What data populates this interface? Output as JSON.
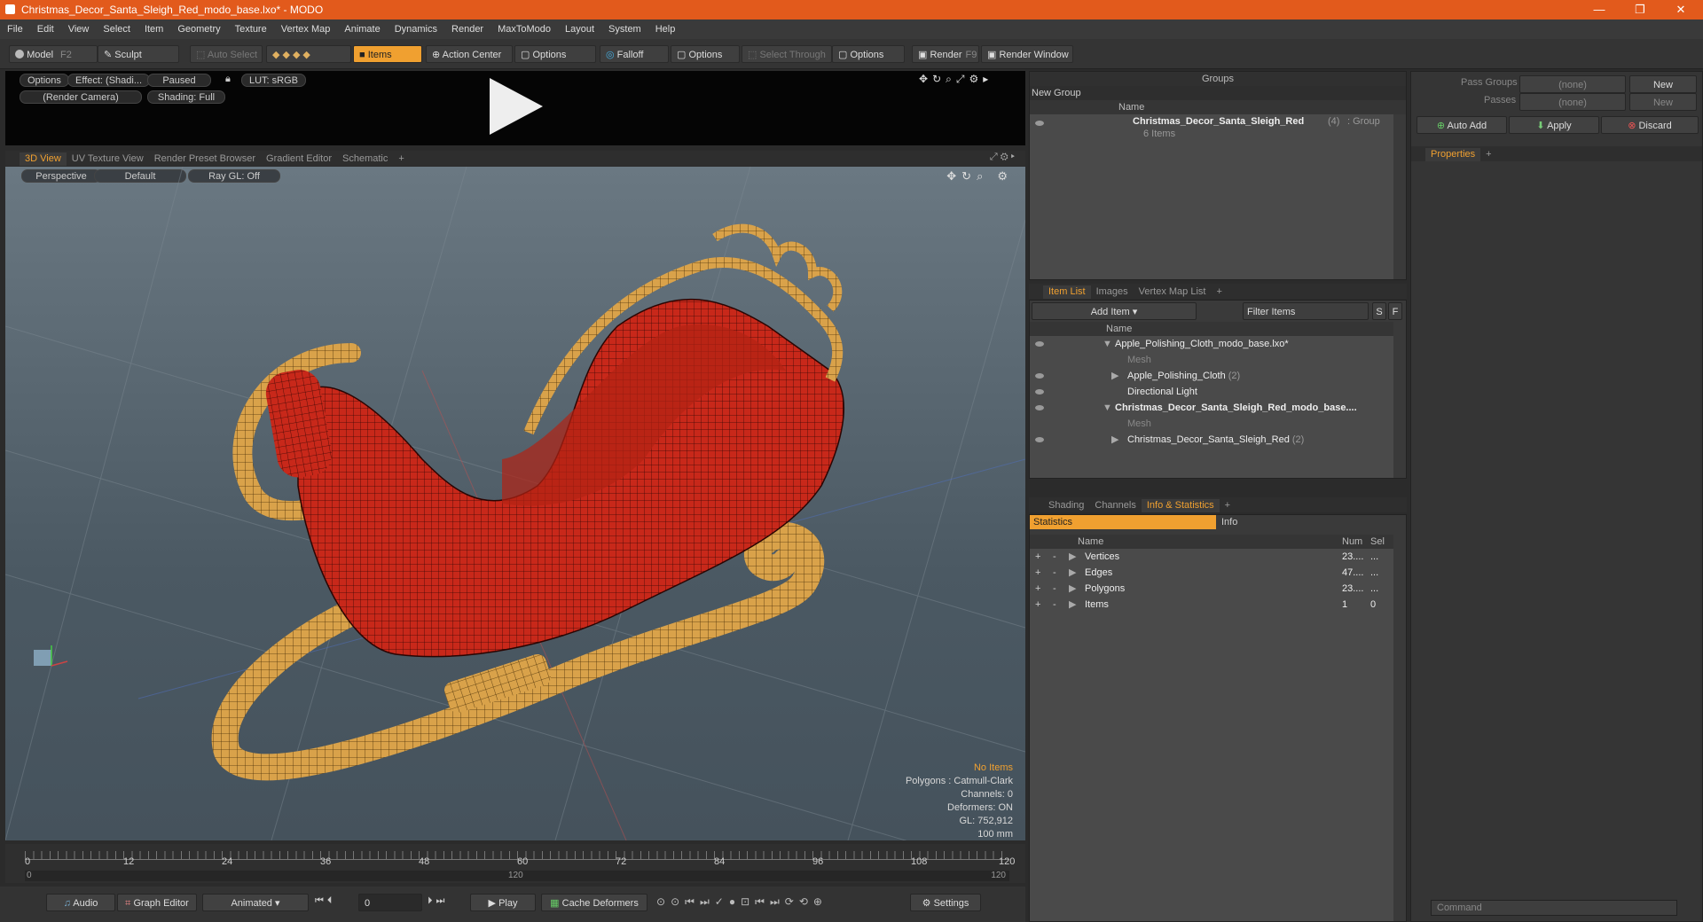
{
  "window": {
    "title": "Christmas_Decor_Santa_Sleigh_Red_modo_base.lxo* - MODO",
    "minimize": "—",
    "maximize": "❐",
    "close": "✕"
  },
  "menu": [
    "File",
    "Edit",
    "View",
    "Select",
    "Item",
    "Geometry",
    "Texture",
    "Vertex Map",
    "Animate",
    "Dynamics",
    "Render",
    "MaxToModo",
    "Layout",
    "System",
    "Help"
  ],
  "toolbar": {
    "model": "Model",
    "model_key": "F2",
    "sculpt": "Sculpt",
    "auto_select": "Auto Select",
    "items": "Items",
    "action_center": "Action Center",
    "options1": "Options",
    "falloff": "Falloff",
    "options2": "Options",
    "select_through": "Select Through",
    "options3": "Options",
    "render": "Render",
    "render_key": "F9",
    "render_window": "Render Window"
  },
  "preview": {
    "options": "Options",
    "effect": "Effect: (Shadi...",
    "paused": "Paused",
    "lut": "LUT: sRGB",
    "camera": "(Render Camera)",
    "shading": "Shading: Full"
  },
  "viewport_tabs": [
    "3D View",
    "UV Texture View",
    "Render Preset Browser",
    "Gradient Editor",
    "Schematic",
    "+"
  ],
  "viewport": {
    "projection": "Perspective",
    "style": "Default",
    "raygl": "Ray GL: Off",
    "info": {
      "selection": "No Items",
      "polygons": "Polygons : Catmull-Clark",
      "channels": "Channels: 0",
      "deformers": "Deformers: ON",
      "gl": "GL: 752,912",
      "scale": "100 mm"
    }
  },
  "timeline": {
    "ticks": [
      "0",
      "12",
      "24",
      "36",
      "48",
      "60",
      "72",
      "84",
      "96",
      "108",
      "120"
    ],
    "range_start": "0",
    "range_mid": "120",
    "range_end": "120"
  },
  "transport": {
    "audio": "Audio",
    "graph_editor": "Graph Editor",
    "animated": "Animated",
    "frame": "0",
    "play": "Play",
    "cache": "Cache Deformers",
    "settings": "Settings"
  },
  "groups": {
    "title": "Groups",
    "new_group": "New Group",
    "col_name": "Name",
    "item_name": "Christmas_Decor_Santa_Sleigh_Red",
    "item_count": "(4)",
    "item_type": ": Group",
    "item_sub": "6 Items"
  },
  "pass": {
    "pass_groups": "Pass Groups",
    "passes": "Passes",
    "none1": "(none)",
    "none2": "(none)",
    "new1": "New",
    "new2": "New",
    "auto_add": "Auto Add",
    "apply": "Apply",
    "discard": "Discard",
    "properties": "Properties",
    "command": "Command"
  },
  "itemlist": {
    "tabs": [
      "Item List",
      "Images",
      "Vertex Map List",
      "+"
    ],
    "add_item": "Add Item",
    "filter": "Filter Items",
    "s": "S",
    "f": "F",
    "col_name": "Name",
    "rows": [
      {
        "label": "Apple_Polishing_Cloth_modo_base.lxo*",
        "bold": false,
        "dim": false,
        "indent": 0,
        "arrow": "▼"
      },
      {
        "label": "Mesh",
        "bold": false,
        "dim": true,
        "indent": 1,
        "arrow": ""
      },
      {
        "label": "Apple_Polishing_Cloth",
        "suffix": "(2)",
        "bold": false,
        "dim": false,
        "indent": 1,
        "arrow": "▶"
      },
      {
        "label": "Directional Light",
        "bold": false,
        "dim": false,
        "indent": 1,
        "arrow": ""
      },
      {
        "label": "Christmas_Decor_Santa_Sleigh_Red_modo_base....",
        "bold": true,
        "dim": false,
        "indent": 0,
        "arrow": "▼"
      },
      {
        "label": "Mesh",
        "bold": false,
        "dim": true,
        "indent": 1,
        "arrow": ""
      },
      {
        "label": "Christmas_Decor_Santa_Sleigh_Red",
        "suffix": "(2)",
        "bold": false,
        "dim": false,
        "indent": 1,
        "arrow": "▶"
      }
    ]
  },
  "stats": {
    "tabs": [
      "Shading",
      "Channels",
      "Info & Statistics",
      "+"
    ],
    "statistics": "Statistics",
    "info": "Info",
    "col_name": "Name",
    "col_num": "Num",
    "col_sel": "Sel",
    "rows": [
      {
        "name": "Vertices",
        "num": "23....",
        "sel": "..."
      },
      {
        "name": "Edges",
        "num": "47....",
        "sel": "..."
      },
      {
        "name": "Polygons",
        "num": "23....",
        "sel": "..."
      },
      {
        "name": "Items",
        "num": "1",
        "sel": "0"
      }
    ]
  },
  "colors": {
    "accent": "#f0a030",
    "title_bar": "#e25a1c",
    "sleigh_red": "#c8281a",
    "sleigh_gold": "#d9a24a"
  }
}
